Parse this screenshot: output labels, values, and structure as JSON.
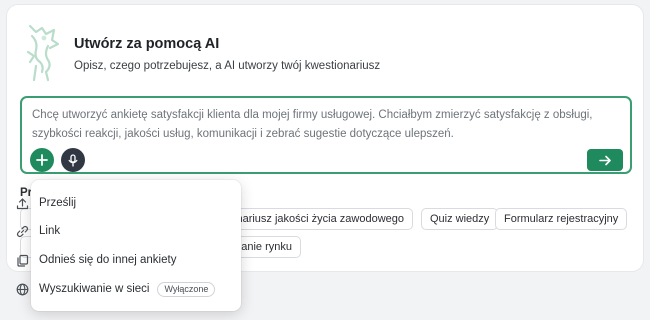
{
  "header": {
    "title": "Utwórz za pomocą AI",
    "subtitle": "Opisz, czego potrzebujesz, a AI utworzy twój kwestionariusz"
  },
  "prompt": {
    "text": "Chcę utworzyć ankietę satysfakcji klienta dla mojej firmy usługowej. Chciałbym zmierzyć satysfakcję z obsługi, szybkości reakcji, jakości usług, komunikacji i zebrać sugestie dotyczące ulepszeń."
  },
  "suggestions": {
    "label_visible": "Pr",
    "chips": [
      "westionariusz jakości życia zawodowego",
      "Quiz wiedzy",
      "Formularz rejestracyjny",
      "badanie rynku"
    ]
  },
  "menu": {
    "items": [
      {
        "label": "Prześlij",
        "icon": "upload-icon"
      },
      {
        "label": "Link",
        "icon": "link-icon"
      },
      {
        "label": "Odnieś się do innej ankiety",
        "icon": "copy-icon"
      },
      {
        "label": "Wyszukiwanie w sieci",
        "icon": "globe-icon",
        "badge": "Wyłączone"
      }
    ]
  },
  "colors": {
    "accent": "#1f8a5d",
    "border_focus": "#3a9e72",
    "mic_button": "#313844"
  }
}
